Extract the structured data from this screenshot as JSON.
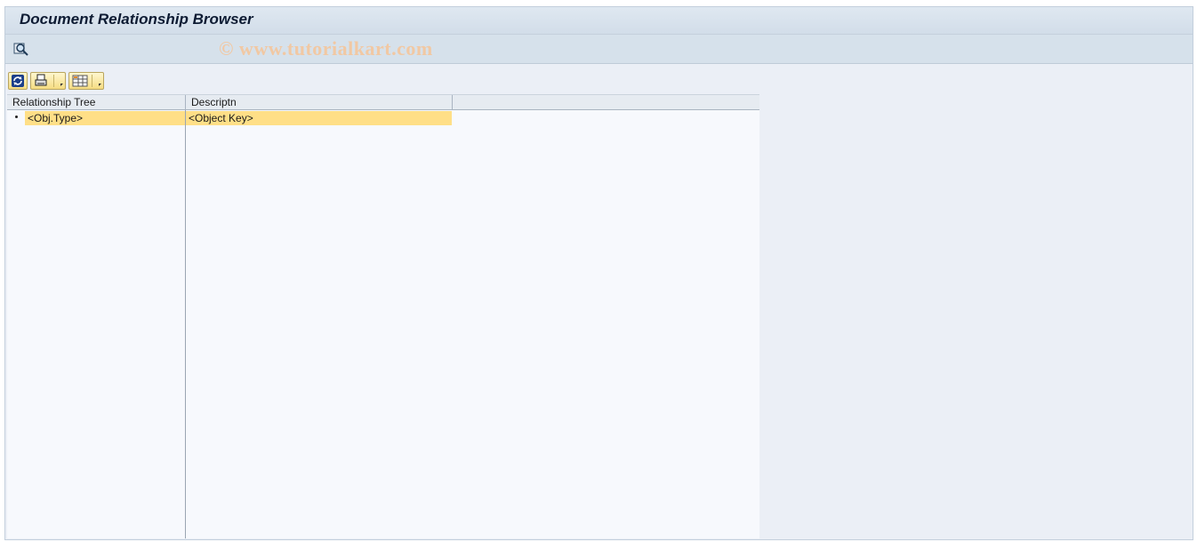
{
  "window": {
    "title": "Document Relationship Browser",
    "watermark": "© www.tutorialkart.com"
  },
  "appbar": {
    "execute_icon": "execute-magnifier-icon"
  },
  "toolbar": {
    "refresh_icon": "refresh-icon",
    "print_icon": "print-icon",
    "layout_icon": "layout-grid-icon"
  },
  "grid": {
    "columns": [
      "Relationship Tree",
      "Descriptn"
    ],
    "rows": [
      {
        "tree": "<Obj.Type>",
        "description": "<Object Key>"
      }
    ]
  },
  "colors": {
    "highlight": "#ffdf87",
    "titlebar": "#dfe8f1",
    "background": "#ebeff6"
  }
}
